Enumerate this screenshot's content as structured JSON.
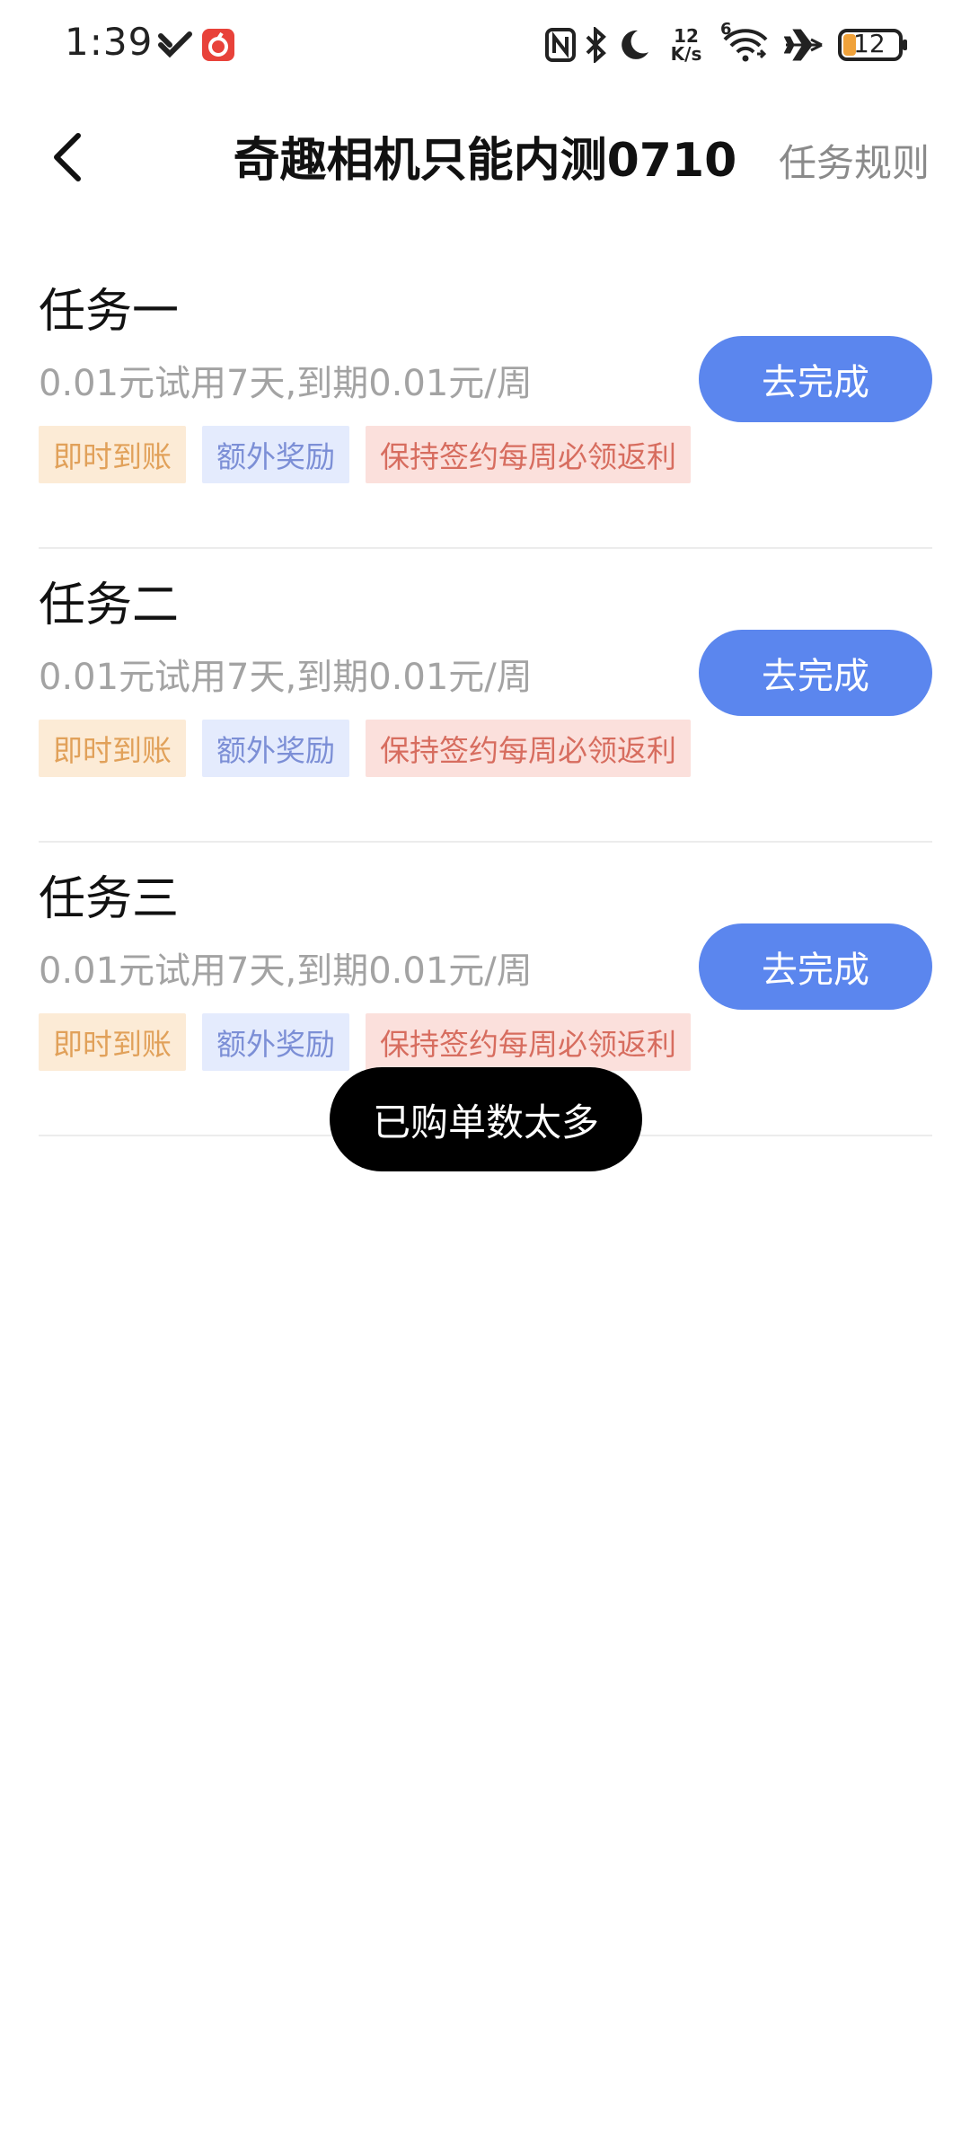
{
  "status_bar": {
    "time": "1:39",
    "net_speed_value": "12",
    "net_speed_unit": "K/s",
    "wifi_badge": "6",
    "battery": "12",
    "icons": [
      "vpn-check-icon",
      "app-notification-icon",
      "nfc-icon",
      "bluetooth-icon",
      "moon-icon",
      "wifi-icon",
      "airplane-icon",
      "battery-icon"
    ],
    "colors": {
      "notification": "#e8423a",
      "battery": "#f0a23a"
    }
  },
  "header": {
    "back_icon": "chevron-left-icon",
    "title": "奇趣相机只能内测0710",
    "rules_label": "任务规则"
  },
  "tasks": [
    {
      "title": "任务一",
      "description": "0.01元试用7天,到期0.01元/周",
      "tags": [
        "即时到账",
        "额外奖励",
        "保持签约每周必领返利"
      ],
      "button_label": "去完成"
    },
    {
      "title": "任务二",
      "description": "0.01元试用7天,到期0.01元/周",
      "tags": [
        "即时到账",
        "额外奖励",
        "保持签约每周必领返利"
      ],
      "button_label": "去完成"
    },
    {
      "title": "任务三",
      "description": "0.01元试用7天,到期0.01元/周",
      "tags": [
        "即时到账",
        "额外奖励",
        "保持签约每周必领返利"
      ],
      "button_label": "去完成"
    }
  ],
  "toast": {
    "message": "已购单数太多"
  },
  "colors": {
    "accent": "#5b86ee",
    "tag_orange_bg": "#fcebd6",
    "tag_orange_text": "#e1a15a",
    "tag_blue_bg": "#e4ebfd",
    "tag_blue_text": "#7c8fd6",
    "tag_red_bg": "#fbe0dc",
    "tag_red_text": "#d76d5f"
  }
}
